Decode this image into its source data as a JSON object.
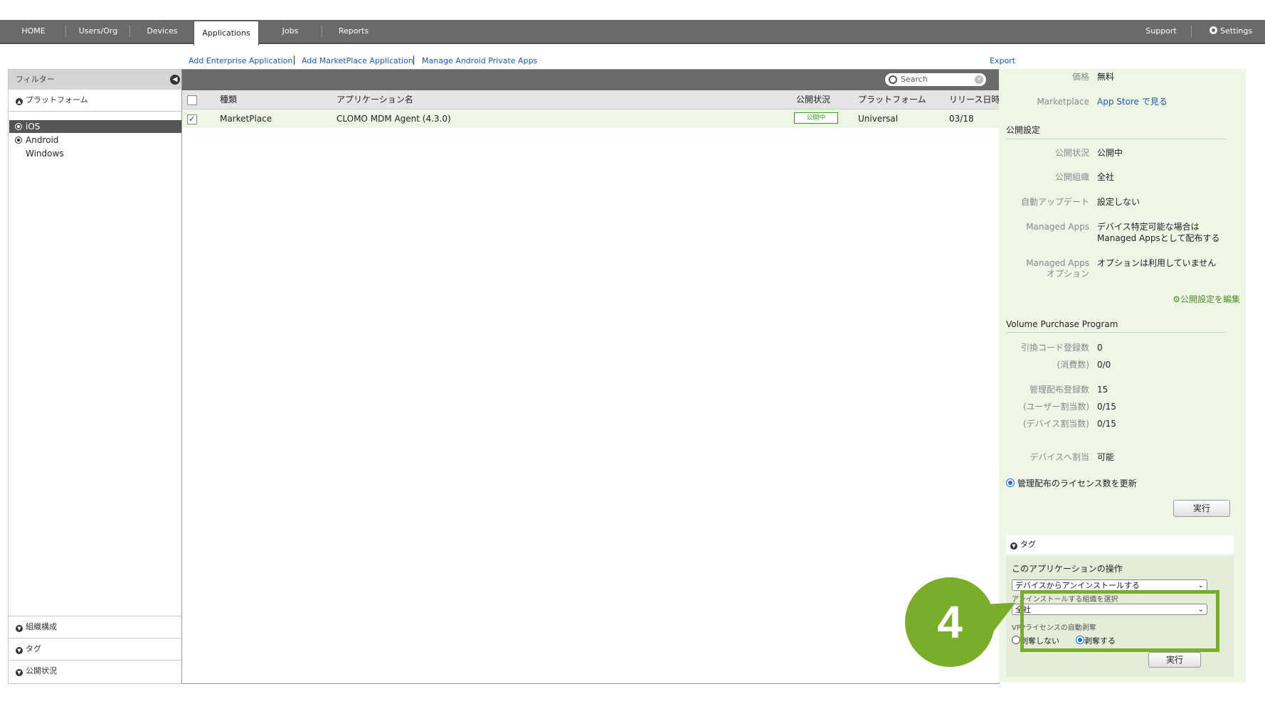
{
  "nav": {
    "tabs": [
      "HOME",
      "Users/Org",
      "Devices",
      "Applications",
      "Jobs",
      "Reports"
    ],
    "active": "Applications",
    "support": "Support",
    "settings": "Settings"
  },
  "subnav": {
    "add_enterprise": "Add Enterprise Application",
    "add_marketplace": "Add MarketPlace Application",
    "manage_android": "Manage Android Private Apps",
    "export": "Export"
  },
  "filter": {
    "title": "フィルター",
    "platform_section": "プラットフォーム",
    "platforms": [
      "iOS",
      "Android",
      "Windows"
    ],
    "selected_platform": "iOS",
    "bottom_sections": [
      "組織構成",
      "タグ",
      "公開状況"
    ]
  },
  "table": {
    "search_placeholder": "Search",
    "columns": [
      "種類",
      "アプリケーション名",
      "公開状況",
      "プラットフォーム",
      "リリース日時"
    ],
    "rows": [
      {
        "checked": true,
        "type": "MarketPlace",
        "name": "CLOMO MDM Agent (4.3.0)",
        "status": "公開中",
        "platform": "Universal",
        "release": "03/18"
      }
    ]
  },
  "detail": {
    "price_label": "価格",
    "price_value": "無料",
    "marketplace_label": "Marketplace",
    "marketplace_link": "App Store で見る",
    "publish_header": "公開設定",
    "publish_status_label": "公開状況",
    "publish_status_value": "公開中",
    "publish_org_label": "公開組織",
    "publish_org_value": "全社",
    "auto_update_label": "自動アップデート",
    "auto_update_value": "設定しない",
    "managed_apps_label": "Managed Apps",
    "managed_apps_value_1": "デバイス特定可能な場合は",
    "managed_apps_value_2": "Managed Appsとして配布する",
    "managed_opt_label_1": "Managed Apps",
    "managed_opt_label_2": "オプション",
    "managed_opt_value": "オプションは利用していません",
    "edit_publish": "公開設定を編集",
    "vpp_header": "Volume Purchase Program",
    "redeem_label": "引換コード登録数",
    "redeem_value": "0",
    "consumed_label": "(消費数)",
    "consumed_value": "0/0",
    "managed_reg_label": "管理配布登録数",
    "managed_reg_value": "15",
    "user_assign_label": "(ユーザー割当数)",
    "user_assign_value": "0/15",
    "device_assign_label": "(デバイス割当数)",
    "device_assign_value": "0/15",
    "device_alloc_label": "デバイスへ割当",
    "device_alloc_value": "可能",
    "update_license": "管理配布のライセンス数を更新",
    "execute": "実行",
    "tag_section": "タグ",
    "ops_title": "このアプリケーションの操作",
    "ops_select": "デバイスからアンインストールする",
    "org_select_label": "アンインストールする組織を選択",
    "org_select_value": "全社",
    "vpp_auto_label": "VPPライセンスの自動剥奪",
    "revoke_no": "剥奪しない",
    "revoke_yes": "剥奪する",
    "execute2": "実行"
  },
  "callout": {
    "step": "4"
  },
  "colors": {
    "accent_green": "#7aad2a",
    "nav_bg": "#6a6a6a",
    "link_blue": "#1b5aa8"
  }
}
